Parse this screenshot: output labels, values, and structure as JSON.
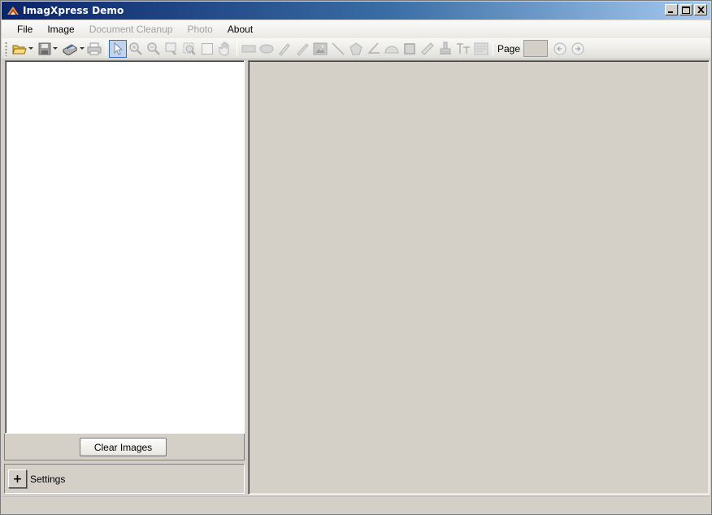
{
  "window": {
    "title": "ImagXpress Demo",
    "controls": [
      "minimize-icon",
      "maximize-icon",
      "close-icon"
    ]
  },
  "menu": {
    "items": [
      {
        "label": "File",
        "enabled": true
      },
      {
        "label": "Image",
        "enabled": true
      },
      {
        "label": "Document Cleanup",
        "enabled": false
      },
      {
        "label": "Photo",
        "enabled": false
      },
      {
        "label": "About",
        "enabled": true
      }
    ]
  },
  "toolbar": {
    "page_label": "Page",
    "page_value": "",
    "tools": [
      "open-icon",
      "save-icon",
      "scan-icon",
      "print-icon",
      "pointer-icon",
      "zoom-in-icon",
      "zoom-out-icon",
      "zoom-rect-icon",
      "magnifier-icon",
      "select-rect-icon",
      "hand-icon",
      "rectangle-icon",
      "ellipse-icon",
      "freehand-icon",
      "highlighter-icon",
      "image-stamp-icon",
      "line-icon",
      "polygon-icon",
      "angle-icon",
      "protractor-icon",
      "box-icon",
      "ruler-icon",
      "rubber-stamp-icon",
      "text-icon",
      "note-icon",
      "prev-page-icon",
      "next-page-icon"
    ],
    "active_tool": "pointer-icon"
  },
  "left_panel": {
    "clear_button": "Clear Images",
    "settings_toggle": "+",
    "settings_label": "Settings"
  },
  "colors": {
    "titlebar_start": "#0a246a",
    "titlebar_end": "#a6caf0",
    "panel_bg": "#d4d0c8",
    "list_bg": "#ffffff"
  }
}
